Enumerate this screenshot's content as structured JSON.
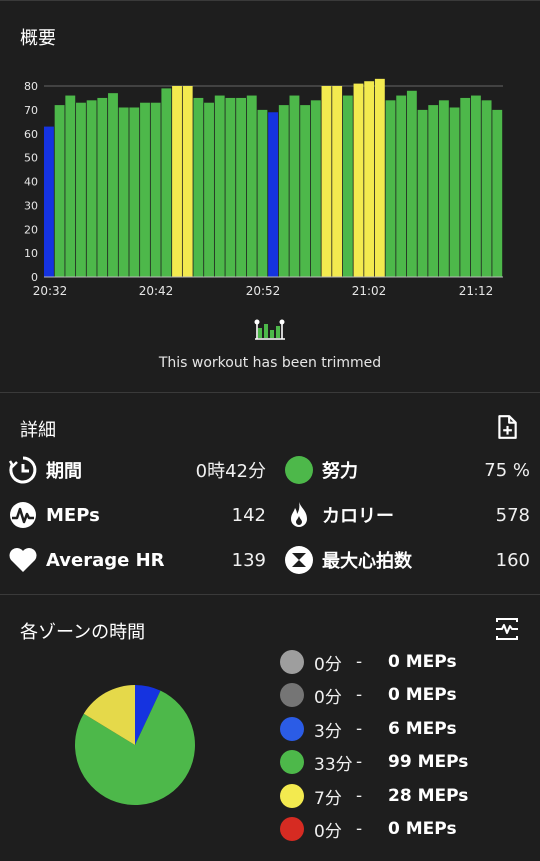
{
  "overview": {
    "title": "概要",
    "trim_message": "This workout has been trimmed"
  },
  "chart_data": {
    "type": "bar",
    "ylim": [
      0,
      80
    ],
    "y_ticks": [
      "0",
      "10",
      "20",
      "30",
      "40",
      "50",
      "60",
      "70",
      "80"
    ],
    "x_ticks": [
      "20:32",
      "20:42",
      "20:52",
      "21:02",
      "21:12"
    ],
    "values": [
      63,
      72,
      76,
      73,
      74,
      75,
      77,
      71,
      71,
      73,
      73,
      79,
      80,
      80,
      75,
      73,
      76,
      75,
      75,
      76,
      70,
      69,
      72,
      76,
      72,
      74,
      80,
      80,
      76,
      81,
      82,
      83,
      74,
      76,
      78,
      70,
      72,
      74,
      71,
      75,
      76,
      74,
      70
    ],
    "zones": [
      "blue",
      "green",
      "green",
      "green",
      "green",
      "green",
      "green",
      "green",
      "green",
      "green",
      "green",
      "green",
      "yellow",
      "yellow",
      "green",
      "green",
      "green",
      "green",
      "green",
      "green",
      "green",
      "blue",
      "green",
      "green",
      "green",
      "green",
      "yellow",
      "yellow",
      "green",
      "yellow",
      "yellow",
      "yellow",
      "green",
      "green",
      "green",
      "green",
      "green",
      "green",
      "green",
      "green",
      "green",
      "green",
      "green"
    ],
    "colors": {
      "blue": "#1533e0",
      "green": "#4db84a",
      "yellow": "#f3ea4f"
    }
  },
  "details": {
    "title": "詳細",
    "stats": [
      {
        "label": "期間",
        "value": "0時42分"
      },
      {
        "label": "努力",
        "value": "75 %"
      },
      {
        "label": "MEPs",
        "value": "142"
      },
      {
        "label": "カロリー",
        "value": "578"
      },
      {
        "label": "Average HR",
        "value": "139"
      },
      {
        "label": "最大心拍数",
        "value": "160"
      }
    ],
    "effort_color": "#4db84a"
  },
  "zones": {
    "title": "各ゾーンの時間",
    "dash": "-",
    "items": [
      {
        "minutes": "0分",
        "meps": "0 MEPs",
        "color": "#9e9e9e"
      },
      {
        "minutes": "0分",
        "meps": "0 MEPs",
        "color": "#757575"
      },
      {
        "minutes": "3分",
        "meps": "6 MEPs",
        "color": "#2b5ce6"
      },
      {
        "minutes": "33分",
        "meps": "99 MEPs",
        "color": "#4db84a"
      },
      {
        "minutes": "7分",
        "meps": "28 MEPs",
        "color": "#f3ea4f"
      },
      {
        "minutes": "0分",
        "meps": "0 MEPs",
        "color": "#d62b22"
      }
    ],
    "pie": [
      {
        "value": 3,
        "color": "#1533e0"
      },
      {
        "value": 33,
        "color": "#4db84a"
      },
      {
        "value": 7,
        "color": "#e5d94a"
      }
    ]
  }
}
